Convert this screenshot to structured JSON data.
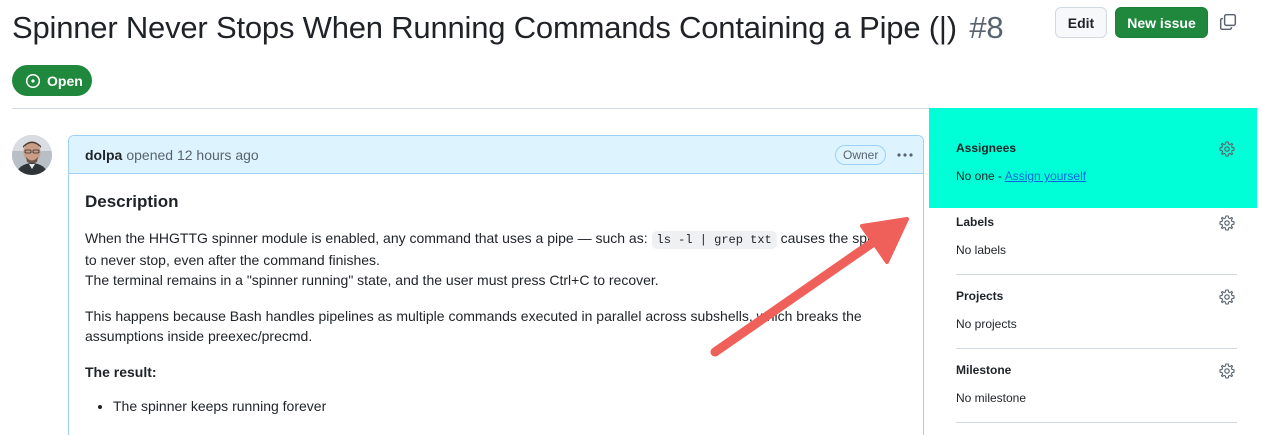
{
  "issue": {
    "title": "Spinner Never Stops When Running Commands Containing a Pipe (|)",
    "number": "#8",
    "state": "Open"
  },
  "header_actions": {
    "edit_label": "Edit",
    "new_issue_label": "New issue",
    "copy_icon": "copy-icon"
  },
  "comment": {
    "author": "dolpa",
    "opened_text": "opened 12 hours ago",
    "role_badge": "Owner",
    "heading": "Description",
    "p1_before": "When the HHGTTG spinner module is enabled, any command that uses a pipe — such as: ",
    "p1_code": "ls -l | grep txt",
    "p1_after": " causes the spinner to never stop, even after the command finishes.",
    "p1_line2": "The terminal remains in a \"spinner running\" state, and the user must press Ctrl+C to recover.",
    "p2": "This happens because Bash handles pipelines as multiple commands executed in parallel across subshells, which breaks the assumptions inside preexec/precmd.",
    "result_heading": "The result:",
    "bullets": [
      "The spinner keeps running forever"
    ]
  },
  "sidebar": {
    "assignees": {
      "title": "Assignees",
      "value_prefix": "No one - ",
      "link": "Assign yourself"
    },
    "labels": {
      "title": "Labels",
      "value": "No labels"
    },
    "projects": {
      "title": "Projects",
      "value": "No projects"
    },
    "milestone": {
      "title": "Milestone",
      "value": "No milestone"
    }
  },
  "colors": {
    "open_green": "#1f883d",
    "highlight": "#00ffd6",
    "annotation_arrow": "#f0605a",
    "link_blue": "#0969da"
  }
}
